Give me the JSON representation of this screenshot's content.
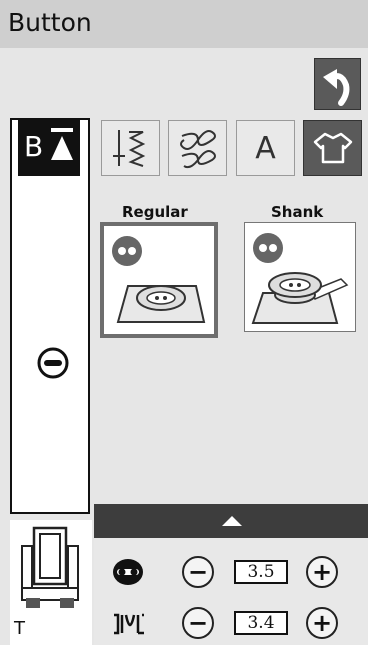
{
  "header": {
    "title": "Button"
  },
  "category_buttons": [
    {
      "icon": "satin-stitch-icon",
      "active": false
    },
    {
      "icon": "decorative-stitch-icon",
      "active": false
    },
    {
      "icon": "alphabet-icon",
      "label": "A",
      "active": false
    },
    {
      "icon": "shirt-icon",
      "active": true
    }
  ],
  "left_panel": {
    "top_button": {
      "letter": "B",
      "icon": "up-triangle-icon"
    },
    "stitch_icon": "buttonhole-icon"
  },
  "stitches": [
    {
      "label": "Regular",
      "selected": true
    },
    {
      "label": "Shank",
      "selected": false
    }
  ],
  "presser_foot": {
    "letter": "T"
  },
  "settings": [
    {
      "icon": "button-width-icon",
      "value": "3.5"
    },
    {
      "icon": "zigzag-width-icon",
      "value": "3.4"
    }
  ],
  "colors": {
    "title_bar": "#cfcfcf",
    "active_button": "#5a5a5a",
    "panel_dark": "#3d3d3d"
  }
}
